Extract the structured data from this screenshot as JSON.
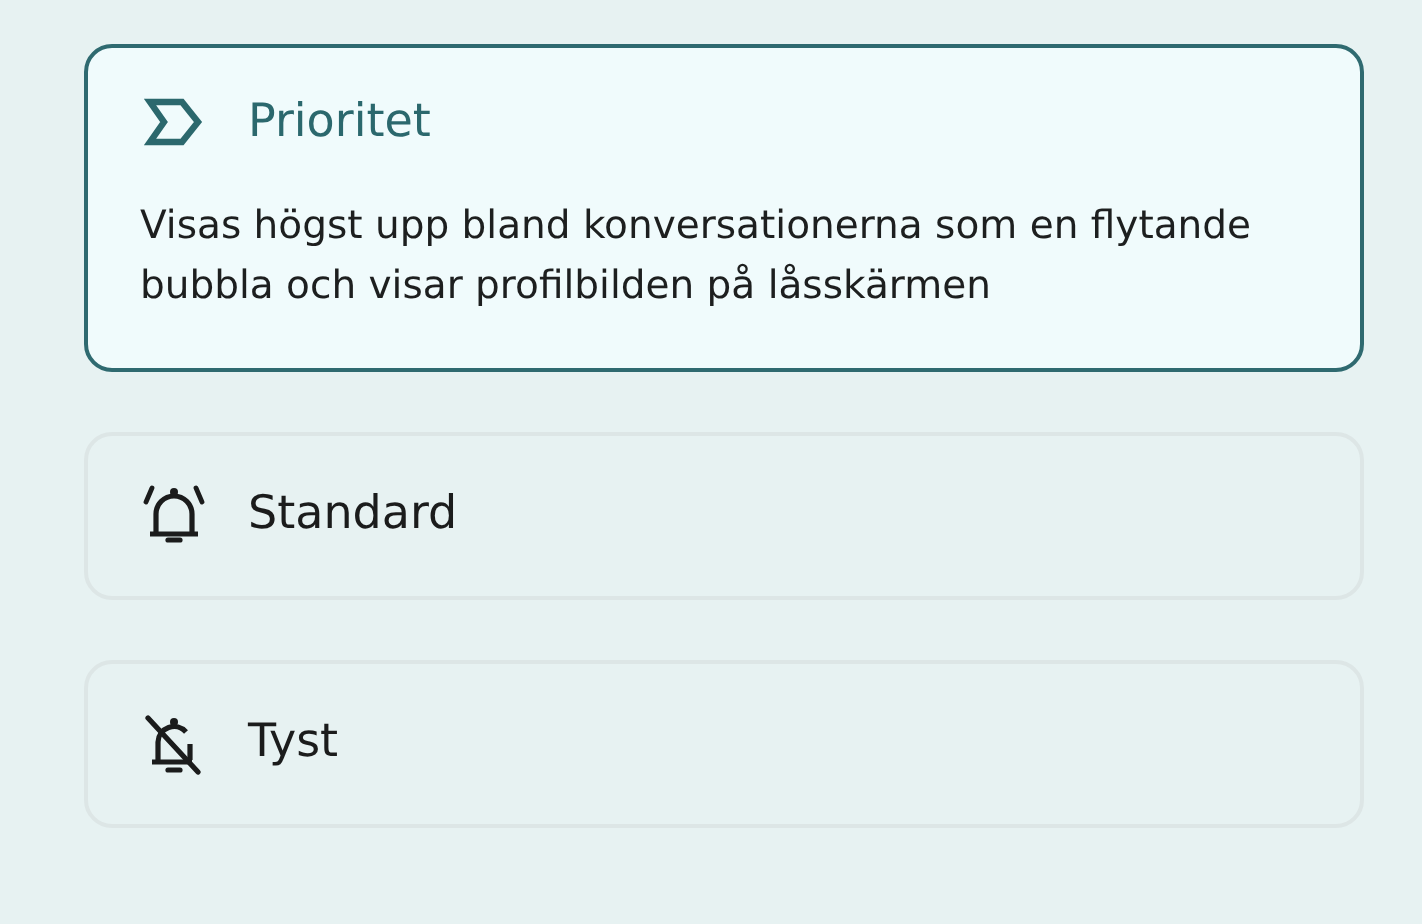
{
  "options": [
    {
      "kind": "priority",
      "label": "Prioritet",
      "selected": true,
      "description": "Visas högst upp bland konversationerna som en flytande bubbla och visar profilbilden på låsskärmen"
    },
    {
      "kind": "alerting",
      "label": "Standard",
      "selected": false
    },
    {
      "kind": "silent",
      "label": "Tyst",
      "selected": false
    }
  ]
}
